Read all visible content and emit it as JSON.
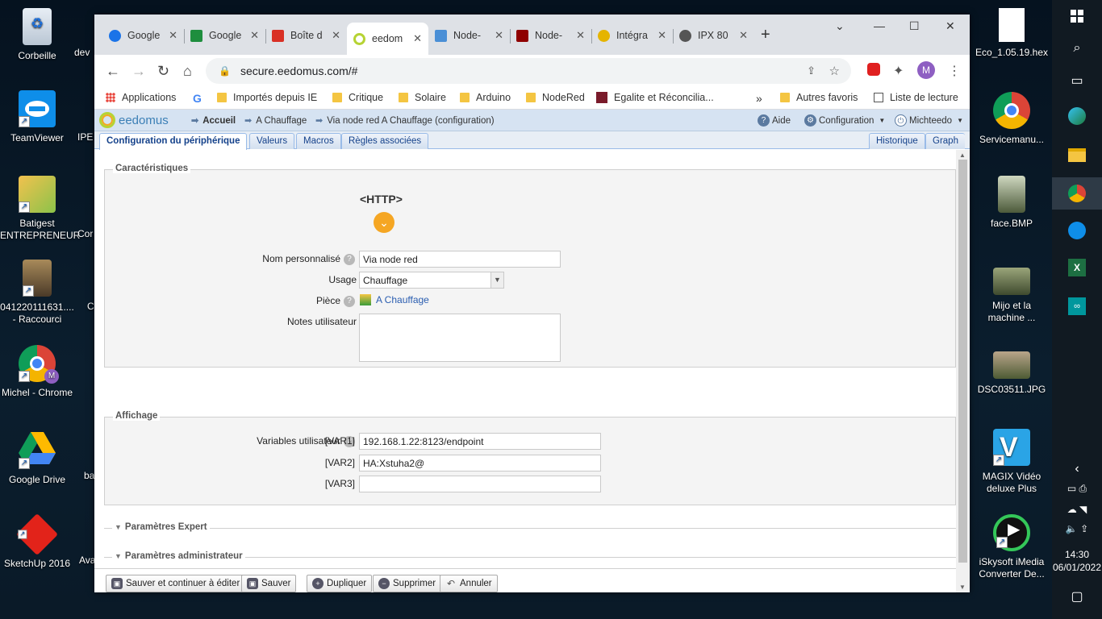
{
  "desktop": {
    "left_icons": [
      {
        "label": "Corbeille"
      },
      {
        "label": "TeamViewer"
      },
      {
        "label": "Batigest ENTREPRENEUR"
      },
      {
        "label": "041220111631.... - Raccourci"
      },
      {
        "label": "Michel - Chrome"
      },
      {
        "label": "Google Drive"
      },
      {
        "label": "SketchUp 2016"
      }
    ],
    "partial_icons": [
      "dev",
      "IPE",
      "Cor",
      "C",
      "ba",
      "Ava"
    ],
    "right_icons": [
      {
        "label": "Eco_1.05.19.hex"
      },
      {
        "label": "Servicemanu..."
      },
      {
        "label": "face.BMP"
      },
      {
        "label": "Mijo et la machine ..."
      },
      {
        "label": "DSC03511.JPG"
      },
      {
        "label": "MAGIX Vidéo deluxe Plus"
      },
      {
        "label": "iSkysoft iMedia Converter De..."
      }
    ]
  },
  "taskbar": {
    "time": "14:30",
    "date": "06/01/2022"
  },
  "browser": {
    "tabs": [
      {
        "title": "Google",
        "color": "#1a73e8"
      },
      {
        "title": "Google",
        "color": "#1e8e3e"
      },
      {
        "title": "Boîte d",
        "color": "#d93025"
      },
      {
        "title": "eedom",
        "color": "#b6d334"
      },
      {
        "title": "Node-",
        "color": "#4a8fd6"
      },
      {
        "title": "Node-",
        "color": "#8f0000"
      },
      {
        "title": "Intégra",
        "color": "#e5b400"
      },
      {
        "title": "IPX 80",
        "color": "#555555"
      }
    ],
    "url": "secure.eedomus.com/#",
    "profile_initial": "M",
    "bookmarks": [
      "Applications",
      "Importés depuis IE",
      "Critique",
      "Solaire",
      "Arduino",
      "NodeRed",
      "Egalite et Réconcilia...",
      "Autres favoris",
      "Liste de lecture"
    ],
    "overflow": "»"
  },
  "app": {
    "logo": "eedomus",
    "breadcrumb": [
      "Accueil",
      "A Chauffage",
      "Via node red A Chauffage (configuration)"
    ],
    "header_right": {
      "help": "Aide",
      "config": "Configuration",
      "user": "Michteedo"
    },
    "tabs": [
      "Configuration du périphérique",
      "Valeurs",
      "Macros",
      "Règles associées"
    ],
    "right_tabs": [
      "Historique",
      "Graph"
    ],
    "caracteristiques": {
      "legend": "Caractéristiques",
      "device_type": "<HTTP>",
      "nom_label": "Nom personnalisé",
      "nom_value": "Via node red",
      "usage_label": "Usage",
      "usage_value": "Chauffage",
      "piece_label": "Pièce",
      "piece_value": "A Chauffage",
      "notes_label": "Notes utilisateur",
      "notes_value": ""
    },
    "affichage": {
      "legend": "Affichage",
      "vars_label": "Variables utilisateur",
      "vars": [
        {
          "tag": "[VAR1]",
          "value": "192.168.1.22:8123/endpoint"
        },
        {
          "tag": "[VAR2]",
          "value": "HA:Xstuha2@"
        },
        {
          "tag": "[VAR3]",
          "value": ""
        }
      ]
    },
    "expert": "Paramètres Expert",
    "admin": "Paramètres administrateur",
    "buttons": {
      "save_continue": "Sauver et continuer à éditer",
      "save": "Sauver",
      "duplicate": "Dupliquer",
      "delete": "Supprimer",
      "cancel": "Annuler"
    }
  },
  "colors": {
    "accent": "#15428b",
    "eedomus_green": "#b6d334",
    "eedomus_orange": "#f5a623"
  }
}
